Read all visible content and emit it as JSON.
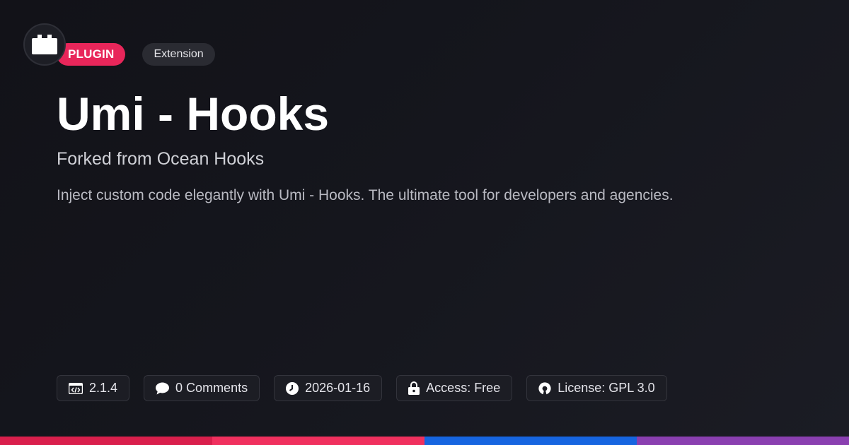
{
  "header": {
    "badge_primary": "PLUGIN",
    "badge_secondary": "Extension"
  },
  "title": "Umi - Hooks",
  "subtitle": "Forked from Ocean Hooks",
  "description": "Inject custom code elegantly with Umi - Hooks. The ultimate tool for developers and agencies.",
  "meta": [
    {
      "icon": "code-icon",
      "label": "2.1.4"
    },
    {
      "icon": "comment-icon",
      "label": "0 Comments"
    },
    {
      "icon": "clock-icon",
      "label": "2026-01-16"
    },
    {
      "icon": "lock-icon",
      "label": "Access: Free"
    },
    {
      "icon": "open-source-icon",
      "label": "License: GPL 3.0"
    }
  ],
  "colors": {
    "accent": "#e8265a",
    "bar": [
      "#d91f4c",
      "#f0305e",
      "#1665e0",
      "#8a3fb0"
    ]
  }
}
